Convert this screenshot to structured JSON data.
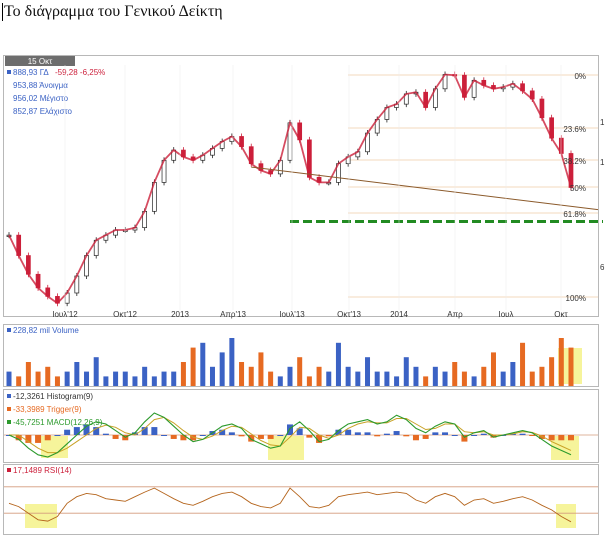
{
  "page_title": "Το διάγραμμα του Γενικού Δείκτη",
  "colors": {
    "price_down": "#cc1f3a",
    "price_up": "#222222",
    "trendline": "#8b5a2b",
    "support": "#228b22",
    "volume_up": "#3b62c4",
    "volume_down": "#e66a22",
    "histogram_pos": "#3b62c4",
    "histogram_neg": "#e66a22",
    "macd": "#2c9a2c",
    "trigger": "#c9a227",
    "rsi": "#b5651d",
    "rsi_band": "#d49b7c",
    "highlight": "#f3f07a",
    "panel_border": "#b8b8b8",
    "date_badge": "#6d6d6d"
  },
  "chart_data": [
    {
      "type": "candlestick",
      "panel": "price",
      "date_badge": "15 Οκτ",
      "legend": [
        {
          "label": "888,93 ΓΔ",
          "change": "-59,28 -6,25%"
        },
        {
          "label": "953,88 Άνοιγμα"
        },
        {
          "label": "956,02 Μέγιστο"
        },
        {
          "label": "852,87 Ελάχιστο"
        }
      ],
      "x_tick_labels": [
        "Ιουλ'12",
        "Οκτ'12",
        "2013",
        "Απρ'13",
        "Ιουλ'13",
        "Οκτ'13",
        "2014",
        "Απρ",
        "Ιουλ",
        "Οκτ"
      ],
      "fib_labels": [
        "0%",
        "23.6%",
        "38.2%",
        "50%",
        "61.8%",
        "100%"
      ],
      "right_axis_fragments": [
        "1",
        "1",
        "6"
      ],
      "closes": [
        820,
        760,
        705,
        665,
        640,
        620,
        650,
        700,
        760,
        805,
        820,
        835,
        835,
        842,
        890,
        975,
        1040,
        1070,
        1050,
        1040,
        1055,
        1075,
        1095,
        1110,
        1080,
        1030,
        1010,
        1000,
        1040,
        1150,
        1100,
        990,
        975,
        975,
        1030,
        1050,
        1065,
        1120,
        1160,
        1195,
        1205,
        1235,
        1240,
        1195,
        1250,
        1292,
        1290,
        1225,
        1275,
        1260,
        1250,
        1255,
        1265,
        1244,
        1220,
        1165,
        1105,
        1060,
        960
      ],
      "trendline": {
        "from": 1080,
        "to": 895
      },
      "support_level": 860
    },
    {
      "type": "bar",
      "panel": "volume",
      "legend": "228,82 mil Volume",
      "values": [
        0.3,
        0.2,
        0.5,
        0.3,
        0.4,
        0.2,
        0.3,
        0.5,
        0.3,
        0.6,
        0.2,
        0.3,
        0.3,
        0.2,
        0.4,
        0.2,
        0.3,
        0.3,
        0.5,
        0.8,
        0.9,
        0.4,
        0.7,
        1.0,
        0.5,
        0.4,
        0.7,
        0.3,
        0.2,
        0.4,
        0.6,
        0.2,
        0.4,
        0.3,
        0.9,
        0.4,
        0.3,
        0.6,
        0.3,
        0.3,
        0.2,
        0.6,
        0.4,
        0.2,
        0.4,
        0.3,
        0.5,
        0.3,
        0.2,
        0.4,
        0.7,
        0.3,
        0.5,
        0.9,
        0.3,
        0.4,
        0.6,
        1.0,
        0.8
      ]
    },
    {
      "type": "line",
      "panel": "macd",
      "legend": [
        "-12,3261 Histogram(9)",
        "-33,3989 Trigger(9)",
        "-45,7251 MACD(12,26,9)"
      ],
      "macd": [
        0,
        -0.2,
        -0.6,
        -0.9,
        -1.0,
        -0.8,
        -0.4,
        0.0,
        0.4,
        0.6,
        0.5,
        0.2,
        -0.1,
        0.1,
        0.6,
        1.0,
        0.8,
        0.4,
        0.0,
        -0.3,
        -0.2,
        0.1,
        0.4,
        0.5,
        0.3,
        -0.2,
        -0.4,
        -0.6,
        -0.5,
        0.3,
        0.6,
        0.2,
        -0.3,
        -0.2,
        0.2,
        0.5,
        0.6,
        0.7,
        0.5,
        0.6,
        0.9,
        0.7,
        0.3,
        0.1,
        0.4,
        0.6,
        0.5,
        -0.1,
        0.1,
        0.2,
        -0.1,
        0.0,
        0.1,
        0.2,
        0.1,
        -0.2,
        -0.5,
        -0.7,
        -0.9
      ],
      "trigger": [
        0,
        0.0,
        -0.3,
        -0.6,
        -0.8,
        -0.8,
        -0.6,
        -0.3,
        0.0,
        0.3,
        0.45,
        0.35,
        0.1,
        0.0,
        0.3,
        0.7,
        0.8,
        0.55,
        0.2,
        -0.1,
        -0.2,
        -0.05,
        0.2,
        0.4,
        0.35,
        0.05,
        -0.25,
        -0.45,
        -0.5,
        -0.1,
        0.35,
        0.3,
        0.0,
        -0.15,
        0.0,
        0.3,
        0.5,
        0.6,
        0.55,
        0.55,
        0.75,
        0.75,
        0.5,
        0.25,
        0.3,
        0.5,
        0.5,
        0.15,
        0.1,
        0.15,
        0.0,
        0.0,
        0.05,
        0.15,
        0.12,
        -0.05,
        -0.3,
        -0.5,
        -0.7
      ]
    },
    {
      "type": "line",
      "panel": "rsi",
      "legend": "17,1489 RSI(14)",
      "ylim": [
        0,
        100
      ],
      "bands": [
        30,
        70
      ],
      "values": [
        45,
        40,
        30,
        20,
        18,
        25,
        45,
        55,
        60,
        58,
        52,
        50,
        48,
        55,
        62,
        68,
        60,
        52,
        45,
        42,
        48,
        55,
        60,
        62,
        55,
        45,
        40,
        38,
        45,
        68,
        55,
        40,
        38,
        42,
        55,
        58,
        60,
        62,
        58,
        60,
        62,
        60,
        50,
        45,
        55,
        60,
        55,
        42,
        50,
        52,
        45,
        48,
        52,
        55,
        50,
        42,
        35,
        25,
        17
      ]
    }
  ]
}
